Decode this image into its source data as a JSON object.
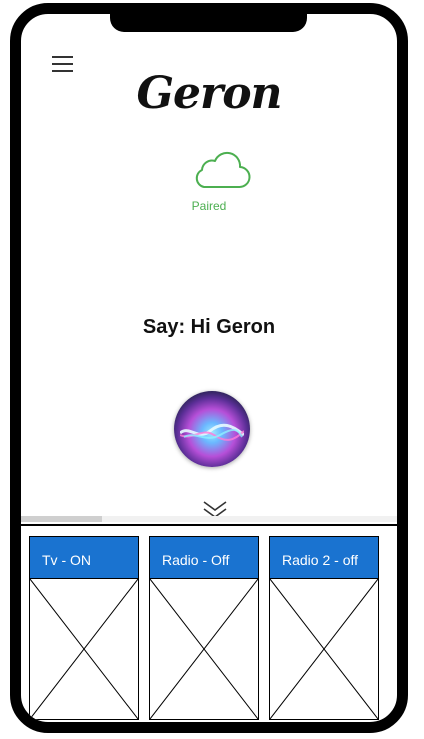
{
  "header": {
    "menu_icon": "hamburger-menu-icon",
    "logo": "Geron"
  },
  "status": {
    "icon": "cloud-icon",
    "label": "Paired",
    "color": "#4caf50"
  },
  "prompt": {
    "text": "Say: Hi Geron"
  },
  "assistant": {
    "icon": "siri-orb-icon"
  },
  "expand": {
    "icon": "double-chevron-down-icon"
  },
  "devices": [
    {
      "label": "Tv - ON"
    },
    {
      "label": "Radio - Off"
    },
    {
      "label": "Radio 2 - off"
    }
  ],
  "colors": {
    "card_header": "#1a73d0",
    "frame": "#000000"
  }
}
